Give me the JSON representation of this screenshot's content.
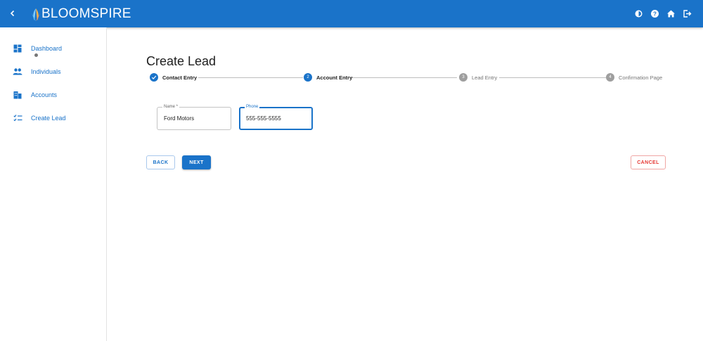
{
  "appbar": {
    "logo_text": "BLOOMSPIRE",
    "icons": [
      "chevron-left-icon",
      "brightness-icon",
      "help-icon",
      "home-icon",
      "logout-icon"
    ]
  },
  "sidebar": {
    "items": [
      {
        "label": "Dashboard",
        "icon": "dashboard-icon"
      },
      {
        "label": "Individuals",
        "icon": "people-icon"
      },
      {
        "label": "Accounts",
        "icon": "accounts-icon"
      },
      {
        "label": "Create Lead",
        "icon": "checklist-icon"
      }
    ]
  },
  "page": {
    "title": "Create Lead"
  },
  "stepper": {
    "steps": [
      {
        "label": "Contact Entry",
        "number": "1",
        "state": "completed"
      },
      {
        "label": "Account Entry",
        "number": "2",
        "state": "active"
      },
      {
        "label": "Lead Entry",
        "number": "3",
        "state": "inactive"
      },
      {
        "label": "Confirmation Page",
        "number": "4",
        "state": "inactive"
      }
    ]
  },
  "form": {
    "name": {
      "label": "Name *",
      "value": "Ford Motors"
    },
    "phone": {
      "label": "Phone",
      "value": "555-555-5555"
    }
  },
  "actions": {
    "back": "BACK",
    "next": "NEXT",
    "cancel": "CANCEL"
  },
  "colors": {
    "primary": "#1a73c9",
    "danger": "#e53935",
    "inactive": "#9e9e9e"
  }
}
